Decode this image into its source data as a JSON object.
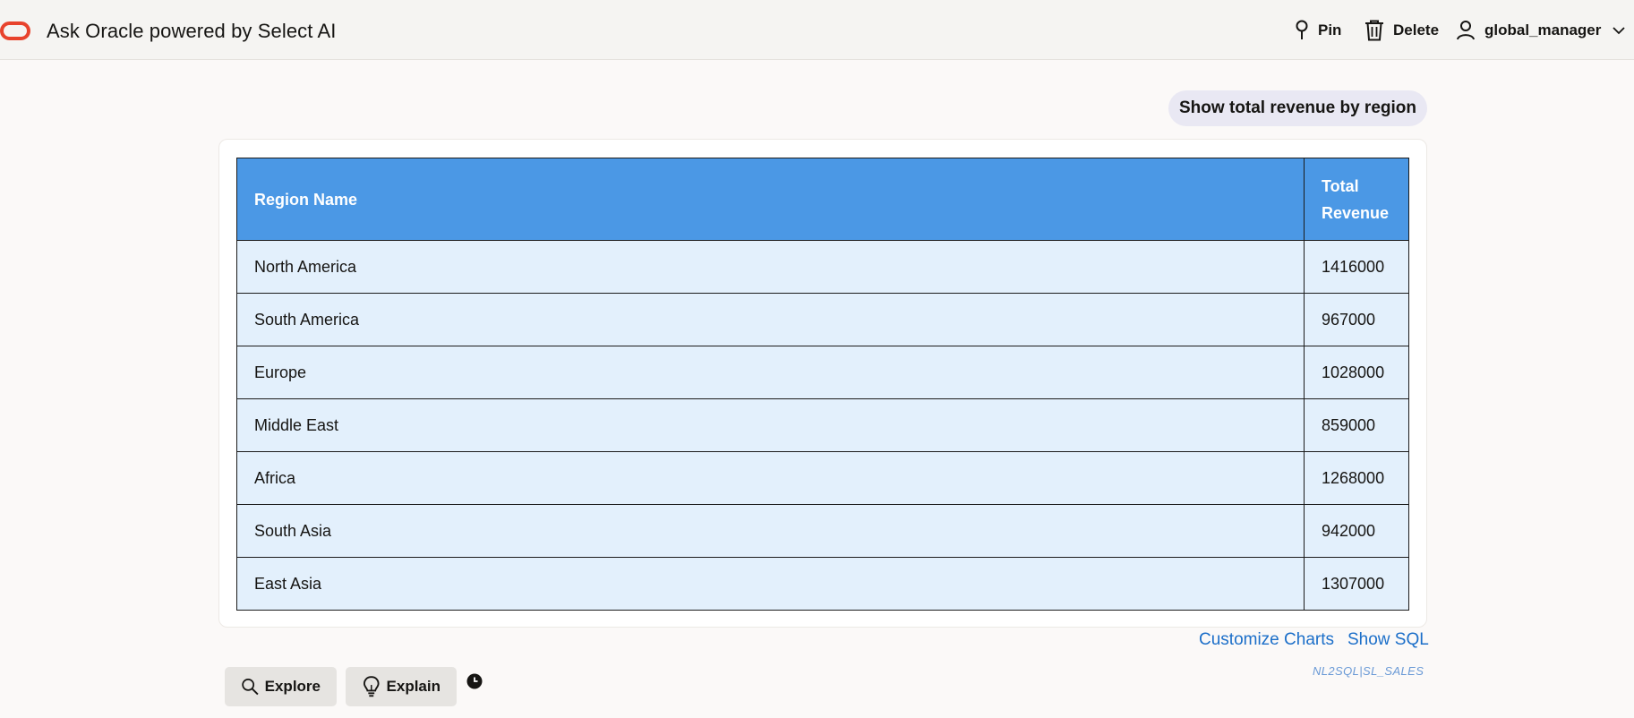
{
  "header": {
    "title": "Ask Oracle powered by Select AI",
    "pin_label": "Pin",
    "delete_label": "Delete",
    "user_name": "global_manager",
    "logo_icon": "oracle-logo-icon"
  },
  "conversation": {
    "query": "Show total revenue by region"
  },
  "results": {
    "columns": [
      "Region Name",
      "Total Revenue"
    ],
    "rows": [
      {
        "region": "North America",
        "revenue": "1416000"
      },
      {
        "region": "South America",
        "revenue": "967000"
      },
      {
        "region": "Europe",
        "revenue": "1028000"
      },
      {
        "region": "Middle East",
        "revenue": "859000"
      },
      {
        "region": "Africa",
        "revenue": "1268000"
      },
      {
        "region": "South Asia",
        "revenue": "942000"
      },
      {
        "region": "East Asia",
        "revenue": "1307000"
      }
    ]
  },
  "links": {
    "customize_charts": "Customize Charts",
    "show_sql": "Show SQL"
  },
  "source_tag": "NL2SQL|SL_SALES",
  "actions": {
    "explore_label": "Explore",
    "explain_label": "Explain"
  },
  "colors": {
    "brand_red": "#c74634",
    "table_header": "#4b98e5",
    "table_row": "#e3f0fc",
    "link_blue": "#1c6fc9",
    "query_bubble": "#e9e8f3"
  }
}
